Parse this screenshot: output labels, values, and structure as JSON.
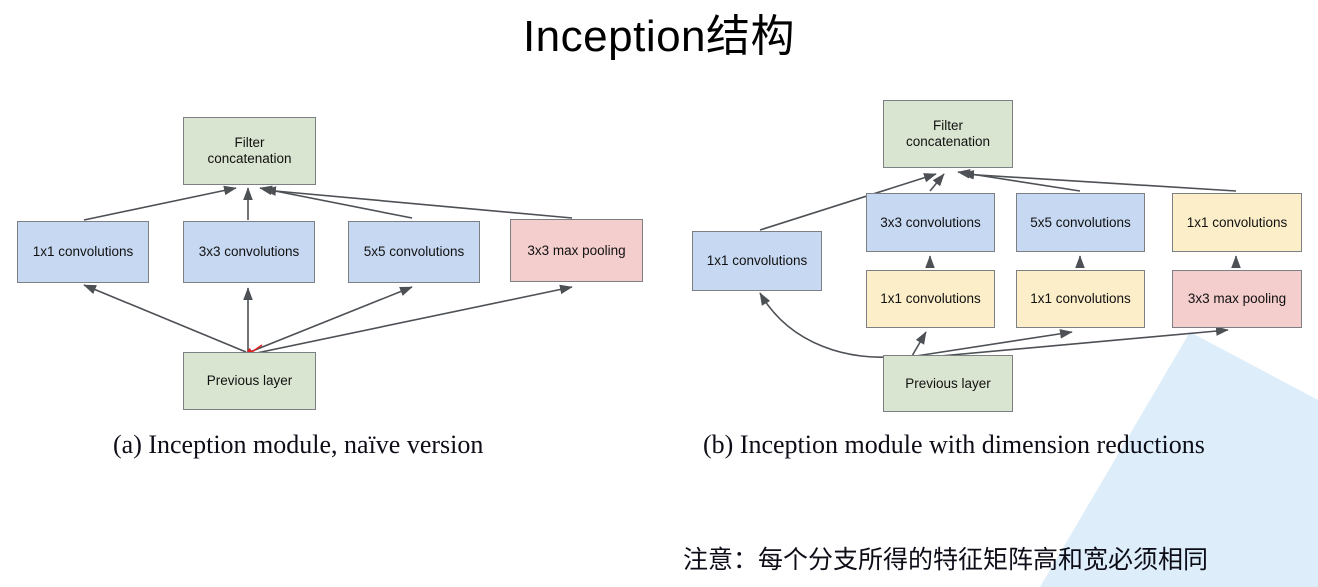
{
  "slide": {
    "title": "Inception结构",
    "background_color": "#ffffff",
    "note": "注意：每个分支所得的特征矩阵高和宽必须相同"
  },
  "palette": {
    "green_fill": "#d9e5d0",
    "blue_fill": "#c7d9f2",
    "red_fill": "#f4cdcd",
    "yellow_fill": "#fbeec8",
    "box_border": "#7c7f84",
    "arrow": "#4d5155",
    "red_arrow": "#e02020",
    "fan_fill": "#ddeefa"
  },
  "diagram_a": {
    "caption": "(a) Inception module, naïve version",
    "nodes": {
      "filter_concat": "Filter\nconcatenation",
      "filter_concat_line1": "Filter",
      "filter_concat_line2": "concatenation",
      "conv1x1": "1x1 convolutions",
      "conv3x3": "3x3 convolutions",
      "conv5x5": "5x5 convolutions",
      "maxpool3x3": "3x3 max pooling",
      "previous_layer": "Previous layer"
    }
  },
  "diagram_b": {
    "caption": "(b) Inception module with dimension reductions",
    "nodes": {
      "filter_concat_line1": "Filter",
      "filter_concat_line2": "concatenation",
      "branch1_conv1x1": "1x1 convolutions",
      "branch2_conv3x3": "3x3 convolutions",
      "branch2_reduce1x1": "1x1 convolutions",
      "branch3_conv5x5": "5x5 convolutions",
      "branch3_reduce1x1": "1x1 convolutions",
      "branch4_proj1x1": "1x1 convolutions",
      "branch4_maxpool3x3": "3x3 max pooling",
      "previous_layer": "Previous layer"
    }
  }
}
